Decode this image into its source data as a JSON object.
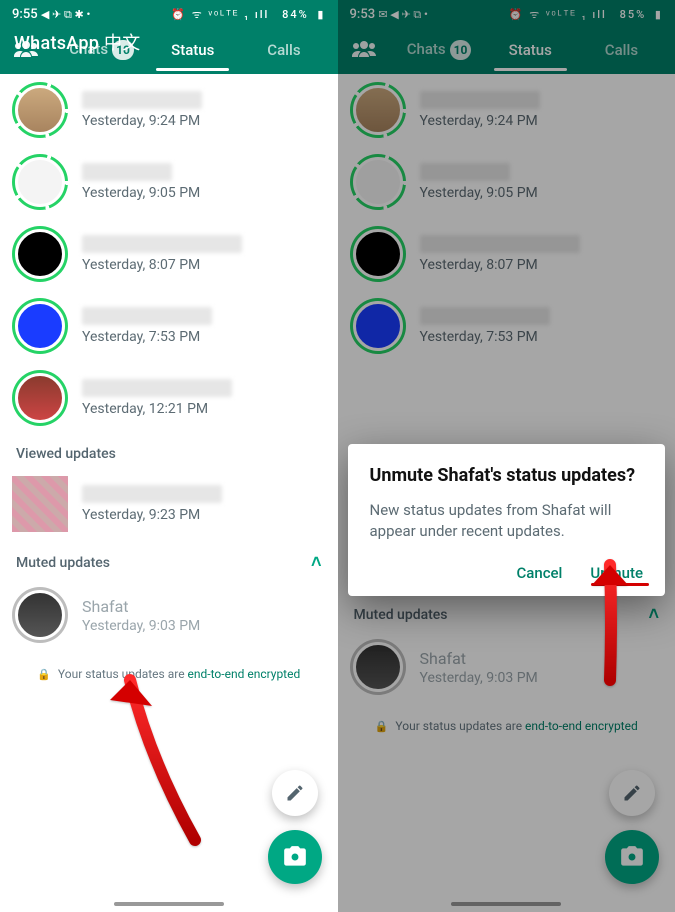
{
  "watermark": "WhatsApp 中文",
  "left": {
    "statusbar": {
      "time": "9:55",
      "left_icons": "◀ ✈ ⧉ ✱ •",
      "battery": "84%",
      "right_icons": "⏰ ᯤ ᵛᵒᴸᵀᴱ ₁ ıll"
    },
    "tabs": {
      "chats": "Chats",
      "chats_badge": "10",
      "status": "Status",
      "calls": "Calls"
    },
    "statuses": [
      {
        "ts": "Yesterday, 9:24 PM",
        "ring": "segmented",
        "av": "bag"
      },
      {
        "ts": "Yesterday, 9:05 PM",
        "ring": "segmented",
        "av": "text"
      },
      {
        "ts": "Yesterday, 8:07 PM",
        "ring": "solid",
        "av": "black"
      },
      {
        "ts": "Yesterday, 7:53 PM",
        "ring": "solid",
        "av": "blue"
      },
      {
        "ts": "Yesterday, 12:21 PM",
        "ring": "solid",
        "av": "brown"
      }
    ],
    "viewed_header": "Viewed updates",
    "viewed": [
      {
        "ts": "Yesterday, 9:23 PM",
        "av": "pix"
      }
    ],
    "muted_header": "Muted updates",
    "muted": [
      {
        "name": "Shafat",
        "ts": "Yesterday, 9:03 PM",
        "av": "dark"
      }
    ],
    "encryption": {
      "prefix": "Your status updates are ",
      "link": "end-to-end encrypted"
    }
  },
  "right": {
    "statusbar": {
      "time": "9:53",
      "left_icons": "✉ ◀ ✈ ⧉ •",
      "battery": "85%",
      "right_icons": "⏰ ᯤ ᵛᵒᴸᵀᴱ ₁ ıll"
    },
    "dialog": {
      "title": "Unmute Shafat's status updates?",
      "body": "New status updates from Shafat will appear under recent updates.",
      "cancel": "Cancel",
      "confirm": "Unmute"
    }
  }
}
